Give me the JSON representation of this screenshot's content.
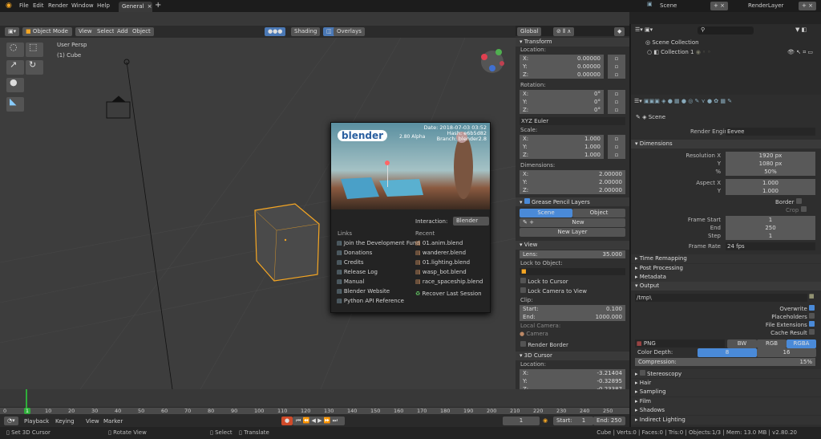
{
  "topbar": {
    "menus": [
      "File",
      "Edit",
      "Render",
      "Window",
      "Help"
    ],
    "workspace_tab": "General",
    "scene": "Scene",
    "view_layer": "RenderLayer"
  },
  "viewport_header": {
    "editor_icon": "3d-view-icon",
    "mode": "Object Mode",
    "menus": [
      "View",
      "Select",
      "Add",
      "Object"
    ],
    "shading": "Shading",
    "overlays": "Overlays",
    "orientation": "Global"
  },
  "viewport": {
    "view_label": "User Persp",
    "object_label": "(1) Cube",
    "accent": "#f5a623"
  },
  "npanel": {
    "transform": "Transform",
    "location": "Location:",
    "rotation": "Rotation:",
    "scale": "Scale:",
    "dimensions": "Dimensions:",
    "rotation_mode": "XYZ Euler",
    "loc": [
      [
        "X:",
        "0.00000"
      ],
      [
        "Y:",
        "0.00000"
      ],
      [
        "Z:",
        "0.00000"
      ]
    ],
    "rot": [
      [
        "X:",
        "0°"
      ],
      [
        "Y:",
        "0°"
      ],
      [
        "Z:",
        "0°"
      ]
    ],
    "scl": [
      [
        "X:",
        "1.000"
      ],
      [
        "Y:",
        "1.000"
      ],
      [
        "Z:",
        "1.000"
      ]
    ],
    "dim": [
      [
        "X:",
        "2.00000"
      ],
      [
        "Y:",
        "2.00000"
      ],
      [
        "Z:",
        "2.00000"
      ]
    ],
    "grease": "Grease Pencil Layers",
    "gp_scene": "Scene",
    "gp_object": "Object",
    "gp_new": "New",
    "gp_new_layer": "New Layer",
    "view": "View",
    "lens_label": "Lens:",
    "lens": "35.000",
    "lock_obj": "Lock to Object:",
    "lock_cursor": "Lock to Cursor",
    "lock_camera": "Lock Camera to View",
    "clip": "Clip:",
    "clip_start_label": "Start:",
    "clip_start": "0.100",
    "clip_end_label": "End:",
    "clip_end": "1000.000",
    "local_camera": "Local Camera:",
    "camera": "Camera",
    "render_border": "Render Border",
    "cursor": "3D Cursor",
    "cursor_loc": "Location:",
    "cur": [
      [
        "X:",
        "-3.21404"
      ],
      [
        "Y:",
        "-0.32895"
      ],
      [
        "Z:",
        "-0.23387"
      ]
    ]
  },
  "outliner": {
    "scene_collection": "Scene Collection",
    "collection": "Collection 1"
  },
  "properties": {
    "scene": "Scene",
    "render_engine_label": "Render Engine",
    "render_engine": "Eevee",
    "dimensions": "Dimensions",
    "rows": [
      [
        "Resolution X",
        "1920 px"
      ],
      [
        "Y",
        "1080 px"
      ],
      [
        "%",
        "50%"
      ],
      [
        "Aspect X",
        "1.000"
      ],
      [
        "Y",
        "1.000"
      ]
    ],
    "border": "Border",
    "crop": "Crop",
    "frames": [
      [
        "Frame Start",
        "1"
      ],
      [
        "End",
        "250"
      ],
      [
        "Step",
        "1"
      ]
    ],
    "frame_rate_label": "Frame Rate",
    "frame_rate": "24 fps",
    "collapsed": [
      "Time Remapping",
      "Post Processing",
      "Metadata"
    ],
    "output": "Output",
    "path": "/tmp\\",
    "checks": [
      [
        "Overwrite",
        true
      ],
      [
        "Placeholders",
        false
      ],
      [
        "File Extensions",
        true
      ],
      [
        "Cache Result",
        false
      ]
    ],
    "format": "PNG",
    "color_modes": [
      "BW",
      "RGB",
      "RGBA"
    ],
    "color_mode_selected": "RGBA",
    "color_depth_label": "Color Depth:",
    "depths": [
      "8",
      "16"
    ],
    "depth_selected": "8",
    "compression_label": "Compression:",
    "compression": "15%",
    "more": [
      "Stereoscopy",
      "Hair",
      "Sampling",
      "Film",
      "Shadows",
      "Indirect Lighting"
    ]
  },
  "splash": {
    "logo": "blender",
    "version": "2.80",
    "alpha": "Alpha",
    "date": "Date: 2018-07-03 03:52",
    "hash": "Hash: e6b5d82",
    "branch": "Branch: blender2.8",
    "interaction_label": "Interaction:",
    "interaction": "Blender",
    "links_title": "Links",
    "recent_title": "Recent",
    "links": [
      "Join the Development Fund",
      "Donations",
      "Credits",
      "Release Log",
      "Manual",
      "Blender Website",
      "Python API Reference"
    ],
    "recent": [
      "01.anim.blend",
      "wanderer.blend",
      "01.lighting.blend",
      "wasp_bot.blend",
      "race_spaceship.blend"
    ],
    "recover": "Recover Last Session"
  },
  "timeline": {
    "current_frame": "1",
    "ticks": [
      "0",
      "1",
      "10",
      "20",
      "30",
      "40",
      "50",
      "60",
      "70",
      "80",
      "90",
      "100",
      "110",
      "120",
      "130",
      "140",
      "150",
      "160",
      "170",
      "180",
      "190",
      "200",
      "210",
      "220",
      "230",
      "240",
      "250"
    ],
    "menus": [
      "Playback",
      "Keying",
      "View",
      "Marker"
    ],
    "frame": "1",
    "start_label": "Start:",
    "start": "1",
    "end_label": "End:",
    "end": "250"
  },
  "status": {
    "hints": [
      "Set 3D Cursor",
      "Rotate View",
      "Select",
      "Translate"
    ],
    "info": "Cube | Verts:0 | Faces:0 | Tris:0 | Objects:1/3 | Mem: 13.0 MB | v2.80.20"
  }
}
